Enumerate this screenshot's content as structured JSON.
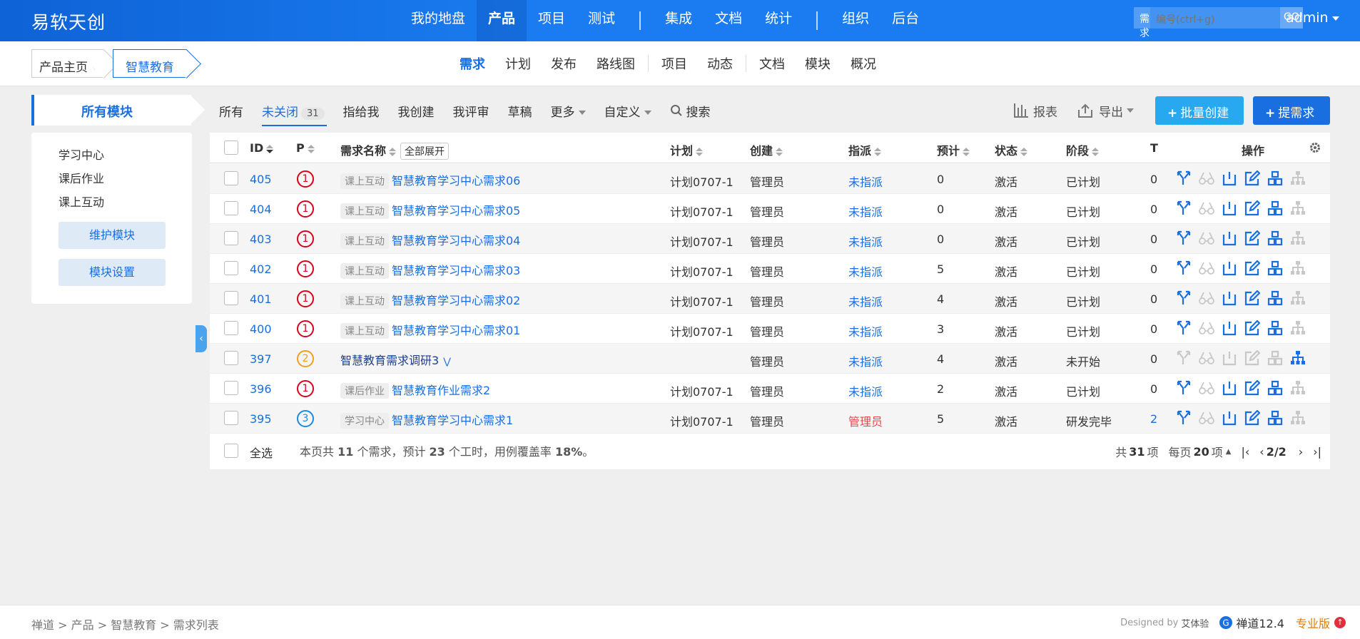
{
  "app": {
    "brand": "易软天创",
    "user": "admin"
  },
  "main_nav": {
    "items": [
      "我的地盘",
      "产品",
      "项目",
      "测试",
      "集成",
      "文档",
      "统计",
      "组织",
      "后台"
    ],
    "active": "产品"
  },
  "search": {
    "type": "需求",
    "placeholder": "编号(ctrl+g)",
    "go": "GO!"
  },
  "product_crumb": {
    "home": "产品主页",
    "current": "智慧教育"
  },
  "sub_nav": {
    "items": [
      "需求",
      "计划",
      "发布",
      "路线图",
      "项目",
      "动态",
      "文档",
      "模块",
      "概况"
    ],
    "active": "需求"
  },
  "modules": {
    "title": "所有模块",
    "items": [
      "学习中心",
      "课后作业",
      "课上互动"
    ],
    "maintain": "维护模块",
    "settings": "模块设置"
  },
  "filters": {
    "all": "所有",
    "unclosed": "未关闭",
    "unclosed_count": "31",
    "assigned": "指给我",
    "created": "我创建",
    "reviewed": "我评审",
    "draft": "草稿",
    "more": "更多",
    "custom": "自定义",
    "search": "搜索"
  },
  "actions": {
    "report": "报表",
    "export": "导出",
    "batch_create": "批量创建",
    "create": "提需求"
  },
  "table": {
    "headers": {
      "id": "ID",
      "pri": "P",
      "name": "需求名称",
      "expand_all": "全部展开",
      "plan": "计划",
      "creator": "创建",
      "assigned": "指派",
      "estimate": "预计",
      "status": "状态",
      "stage": "阶段",
      "t": "T",
      "actions": "操作"
    },
    "rows": [
      {
        "id": "405",
        "pri": "1",
        "module": "课上互动",
        "name": "智慧教育学习中心需求06",
        "plan": "计划0707-1",
        "creator": "管理员",
        "assigned": "未指派",
        "estimate": "0",
        "status": "激活",
        "stage": "已计划",
        "t": "0"
      },
      {
        "id": "404",
        "pri": "1",
        "module": "课上互动",
        "name": "智慧教育学习中心需求05",
        "plan": "计划0707-1",
        "creator": "管理员",
        "assigned": "未指派",
        "estimate": "0",
        "status": "激活",
        "stage": "已计划",
        "t": "0"
      },
      {
        "id": "403",
        "pri": "1",
        "module": "课上互动",
        "name": "智慧教育学习中心需求04",
        "plan": "计划0707-1",
        "creator": "管理员",
        "assigned": "未指派",
        "estimate": "0",
        "status": "激活",
        "stage": "已计划",
        "t": "0"
      },
      {
        "id": "402",
        "pri": "1",
        "module": "课上互动",
        "name": "智慧教育学习中心需求03",
        "plan": "计划0707-1",
        "creator": "管理员",
        "assigned": "未指派",
        "estimate": "5",
        "status": "激活",
        "stage": "已计划",
        "t": "0"
      },
      {
        "id": "401",
        "pri": "1",
        "module": "课上互动",
        "name": "智慧教育学习中心需求02",
        "plan": "计划0707-1",
        "creator": "管理员",
        "assigned": "未指派",
        "estimate": "4",
        "status": "激活",
        "stage": "已计划",
        "t": "0"
      },
      {
        "id": "400",
        "pri": "1",
        "module": "课上互动",
        "name": "智慧教育学习中心需求01",
        "plan": "计划0707-1",
        "creator": "管理员",
        "assigned": "未指派",
        "estimate": "3",
        "status": "激活",
        "stage": "已计划",
        "t": "0"
      },
      {
        "id": "397",
        "pri": "2",
        "module": "",
        "name": "智慧教育需求调研3",
        "plan": "",
        "creator": "管理员",
        "assigned": "未指派",
        "estimate": "4",
        "status": "激活",
        "stage": "未开始",
        "t": "0"
      },
      {
        "id": "396",
        "pri": "1",
        "module": "课后作业",
        "name": "智慧教育作业需求2",
        "plan": "计划0707-1",
        "creator": "管理员",
        "assigned": "未指派",
        "estimate": "2",
        "status": "激活",
        "stage": "已计划",
        "t": "0"
      },
      {
        "id": "395",
        "pri": "3",
        "module": "学习中心",
        "name": "智慧教育学习中心需求1",
        "plan": "计划0707-1",
        "creator": "管理员",
        "assigned": "管理员",
        "estimate": "5",
        "status": "激活",
        "stage": "研发完毕",
        "t": "2"
      }
    ]
  },
  "summary": {
    "select_all": "全选",
    "text_pre": "本页共 ",
    "count": "11",
    "text_mid": " 个需求，预计 ",
    "hours": "23",
    "text_mid2": " 个工时，用例覆盖率 ",
    "coverage": "18%",
    "text_end": "。"
  },
  "pager": {
    "total_pre": "共",
    "total": "31",
    "total_post": "项",
    "per_pre": "每页",
    "per": "20",
    "per_post": "项",
    "page": "2/2"
  },
  "footer": {
    "crumbs": [
      "禅道",
      "产品",
      "智慧教育",
      "需求列表"
    ],
    "designed": "Designed by",
    "designer": "艾体验",
    "version": "禅道12.4",
    "edition": "专业版"
  },
  "colors": {
    "primary": "#1a6fe0",
    "topbar": "#1a7cf0",
    "light_button": "#27a8f0",
    "danger": "#d9001b"
  }
}
